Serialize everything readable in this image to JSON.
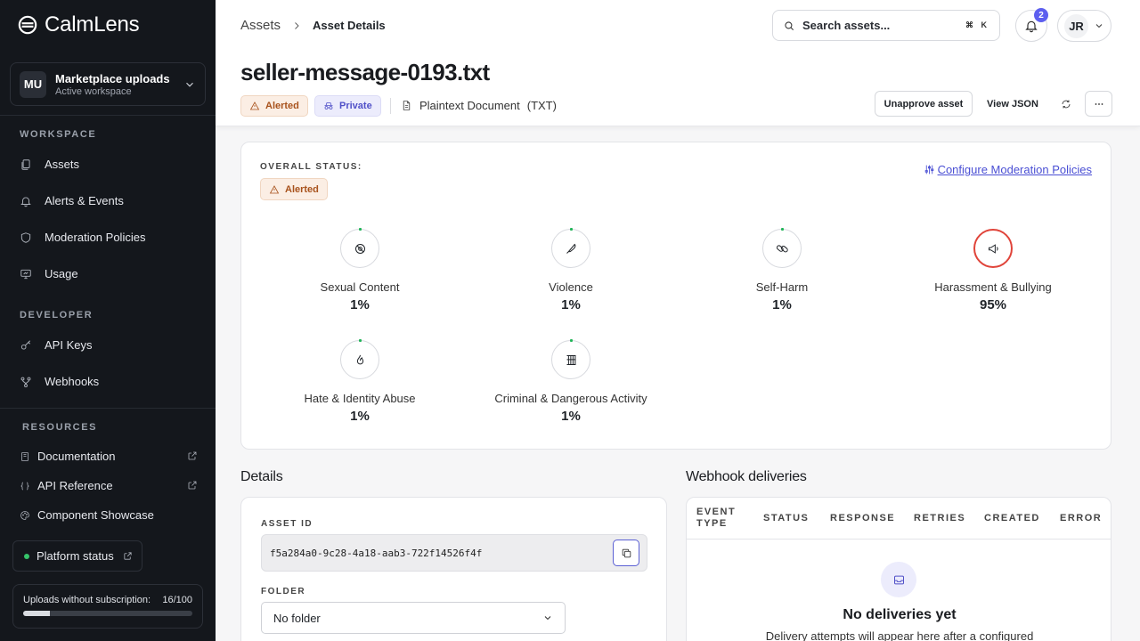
{
  "app": {
    "name": "CalmLens"
  },
  "workspace": {
    "initials": "MU",
    "name": "Marketplace uploads",
    "subtitle": "Active workspace"
  },
  "sidebar": {
    "workspace_label": "WORKSPACE",
    "workspace_items": [
      {
        "label": "Assets",
        "icon": "files-icon"
      },
      {
        "label": "Alerts & Events",
        "icon": "bell-icon"
      },
      {
        "label": "Moderation Policies",
        "icon": "shield-icon"
      },
      {
        "label": "Usage",
        "icon": "monitor-icon"
      }
    ],
    "developer_label": "DEVELOPER",
    "developer_items": [
      {
        "label": "API Keys",
        "icon": "key-icon"
      },
      {
        "label": "Webhooks",
        "icon": "webhook-icon"
      }
    ],
    "resources_label": "RESOURCES",
    "resources_items": [
      {
        "label": "Documentation",
        "icon": "book-icon",
        "external": true
      },
      {
        "label": "API Reference",
        "icon": "braces-icon",
        "external": true
      },
      {
        "label": "Component Showcase",
        "icon": "palette-icon",
        "external": false
      }
    ],
    "platform_status": "Platform status",
    "uploads": {
      "label": "Uploads without subscription:",
      "count": "16/100",
      "fraction": 0.16
    }
  },
  "header": {
    "breadcrumb": [
      "Assets",
      "Asset Details"
    ],
    "search_placeholder": "Search assets...",
    "shortcut": "⌘ K",
    "notifications": "2",
    "user_initials": "JR"
  },
  "asset": {
    "title": "seller-message-0193.txt",
    "status": "Alerted",
    "visibility": "Private",
    "file_type": "Plaintext Document",
    "file_ext": "(TXT)"
  },
  "actions": {
    "unapprove": "Unapprove asset",
    "view_json": "View JSON"
  },
  "overall": {
    "label": "OVERALL STATUS:",
    "status": "Alerted",
    "configure_link": "Configure Moderation Policies",
    "categories": [
      {
        "name": "Sexual Content",
        "score": "1%",
        "icon": "eye-off-icon",
        "flagged": false
      },
      {
        "name": "Violence",
        "score": "1%",
        "icon": "knife-icon",
        "flagged": false
      },
      {
        "name": "Self-Harm",
        "score": "1%",
        "icon": "pill-icon",
        "flagged": false
      },
      {
        "name": "Harassment & Bullying",
        "score": "95%",
        "icon": "megaphone-icon",
        "flagged": true
      },
      {
        "name": "Hate & Identity Abuse",
        "score": "1%",
        "icon": "flame-icon",
        "flagged": false
      },
      {
        "name": "Criminal & Dangerous Activity",
        "score": "1%",
        "icon": "jail-bars-icon",
        "flagged": false
      }
    ]
  },
  "details": {
    "heading": "Details",
    "asset_id_label": "ASSET ID",
    "asset_id": "f5a284a0-9c28-4a18-aab3-722f14526f4f",
    "folder_label": "FOLDER",
    "folder_value": "No folder"
  },
  "webhooks": {
    "heading": "Webhook deliveries",
    "columns": [
      "EVENT TYPE",
      "STATUS",
      "RESPONSE",
      "RETRIES",
      "CREATED",
      "ERROR"
    ],
    "empty_title": "No deliveries yet",
    "empty_text": "Delivery attempts will appear here after a configured"
  }
}
